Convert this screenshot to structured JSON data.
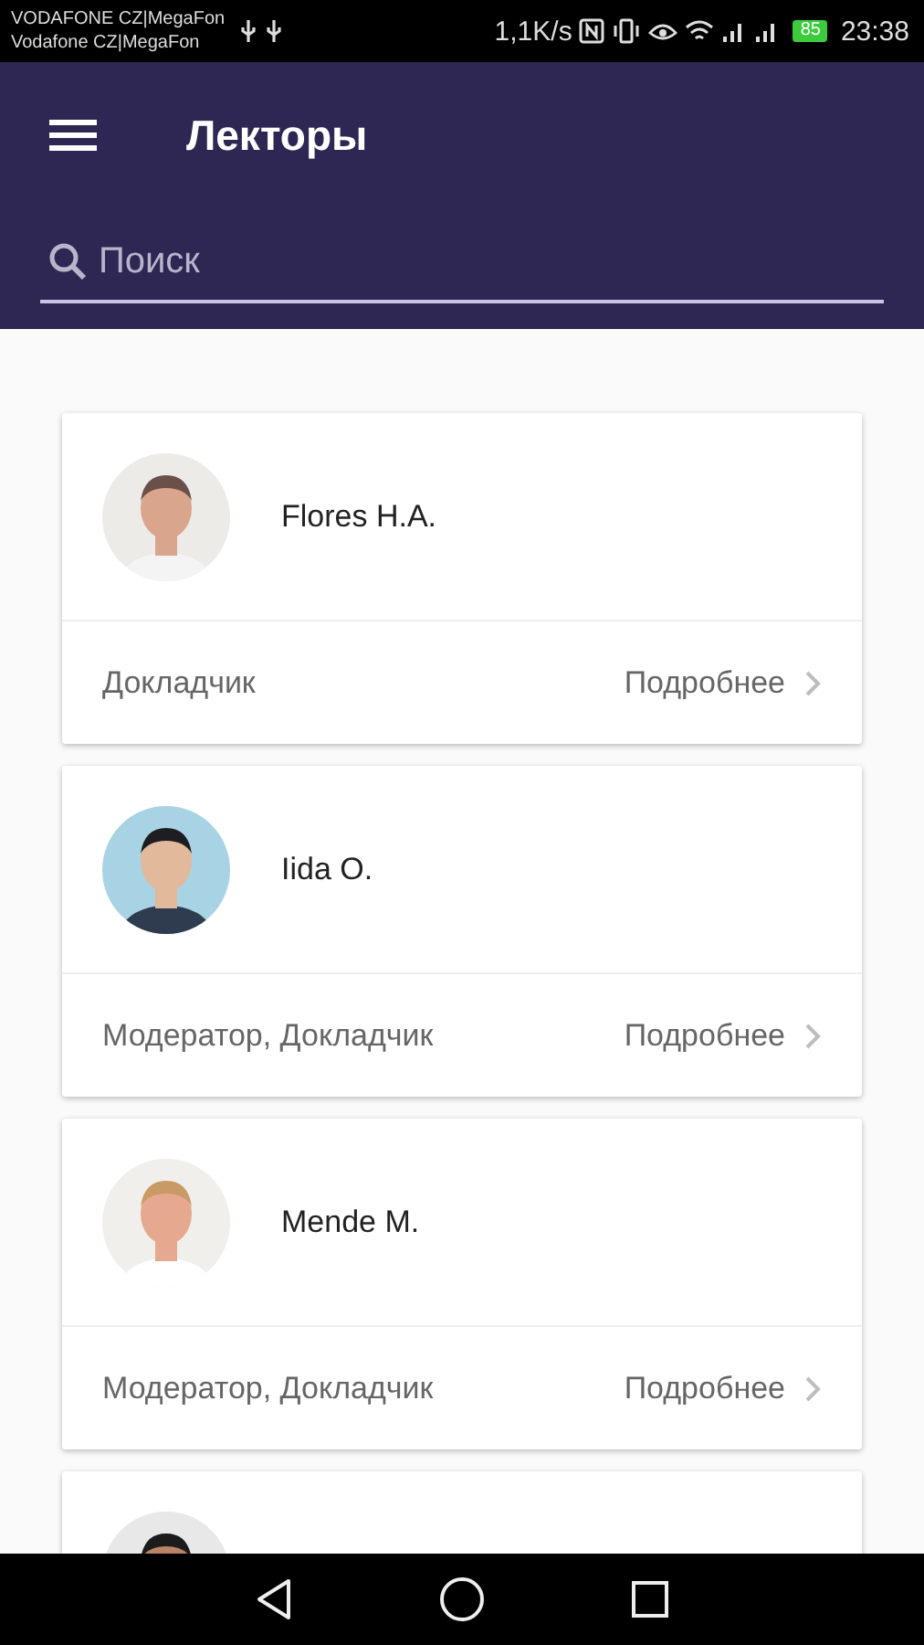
{
  "status_bar": {
    "carrier_1": "VODAFONE CZ|MegaFon",
    "carrier_2": "Vodafone CZ|MegaFon",
    "speed": "1,1K/s",
    "battery": "85",
    "time": "23:38"
  },
  "app_bar": {
    "title": "Лекторы"
  },
  "search": {
    "placeholder": "Поиск"
  },
  "speakers": [
    {
      "kind": "card",
      "name": "Flores H.A.",
      "role": "Докладчик",
      "link": "Подробнее"
    },
    {
      "kind": "card",
      "name": "Iida O.",
      "role": "Модератор, Докладчик",
      "link": "Подробнее"
    },
    {
      "kind": "card",
      "name": "Mende M.",
      "role": "Модератор, Докладчик",
      "link": "Подробнее"
    },
    {
      "kind": "partial"
    }
  ]
}
